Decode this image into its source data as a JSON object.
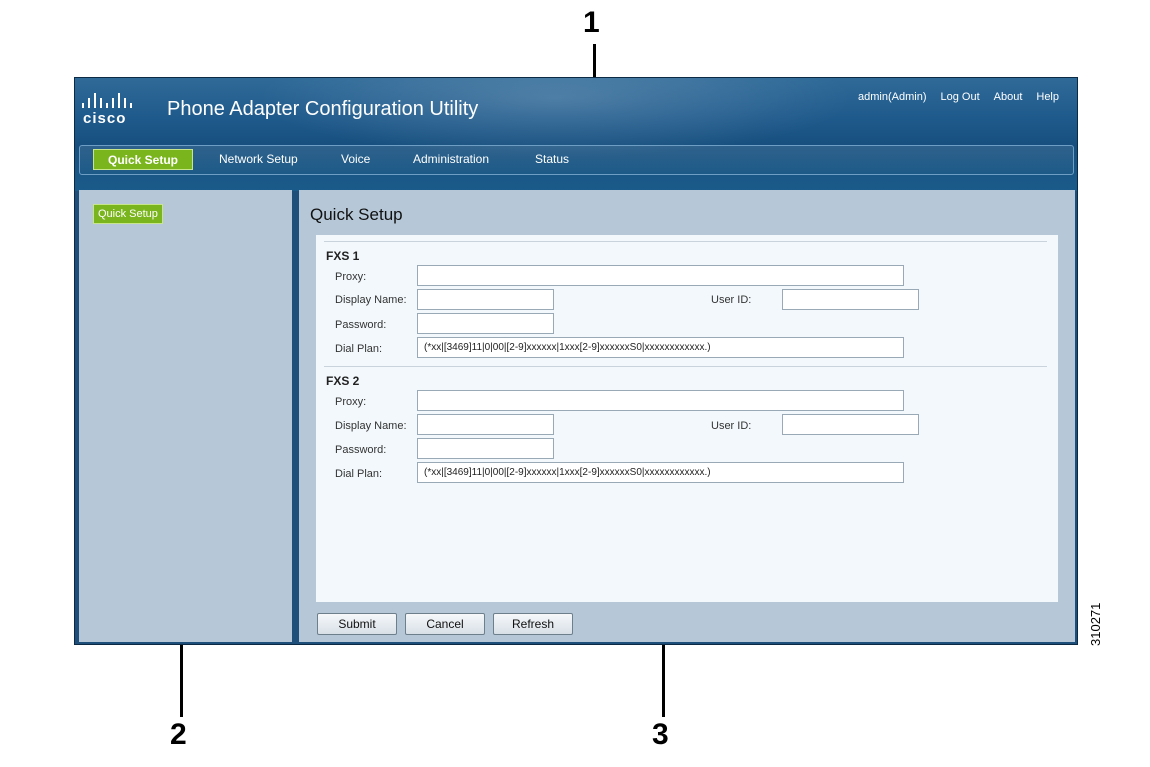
{
  "callouts": {
    "one": "1",
    "two": "2",
    "three": "3"
  },
  "figure_id": "310271",
  "app": {
    "logo_text": "cisco",
    "title": "Phone Adapter Configuration Utility",
    "logo_icon": "cisco-logo-bars-icon"
  },
  "top_links": {
    "user": "admin(Admin)",
    "logout": "Log Out",
    "about": "About",
    "help": "Help"
  },
  "nav": {
    "quick_setup": "Quick Setup",
    "network_setup": "Network Setup",
    "voice": "Voice",
    "administration": "Administration",
    "status": "Status",
    "active_color": "#7ab51d"
  },
  "sidebar": {
    "items": [
      {
        "label": "Quick Setup"
      }
    ]
  },
  "page": {
    "title": "Quick Setup"
  },
  "fxs1": {
    "heading": "FXS 1",
    "proxy_label": "Proxy:",
    "proxy_value": "",
    "display_name_label": "Display Name:",
    "display_name_value": "",
    "user_id_label": "User ID:",
    "user_id_value": "",
    "password_label": "Password:",
    "password_value": "",
    "dial_plan_label": "Dial Plan:",
    "dial_plan_value": "(*xx|[3469]11|0|00|[2-9]xxxxxx|1xxx[2-9]xxxxxxS0|xxxxxxxxxxxx.)"
  },
  "fxs2": {
    "heading": "FXS 2",
    "proxy_label": "Proxy:",
    "proxy_value": "",
    "display_name_label": "Display Name:",
    "display_name_value": "",
    "user_id_label": "User ID:",
    "user_id_value": "",
    "password_label": "Password:",
    "password_value": "",
    "dial_plan_label": "Dial Plan:",
    "dial_plan_value": "(*xx|[3469]11|0|00|[2-9]xxxxxx|1xxx[2-9]xxxxxxS0|xxxxxxxxxxxx.)"
  },
  "buttons": {
    "submit": "Submit",
    "cancel": "Cancel",
    "refresh": "Refresh"
  },
  "colors": {
    "header": "#1f5a8c",
    "pane": "#b6c8d8",
    "content": "#f2f8fb"
  }
}
